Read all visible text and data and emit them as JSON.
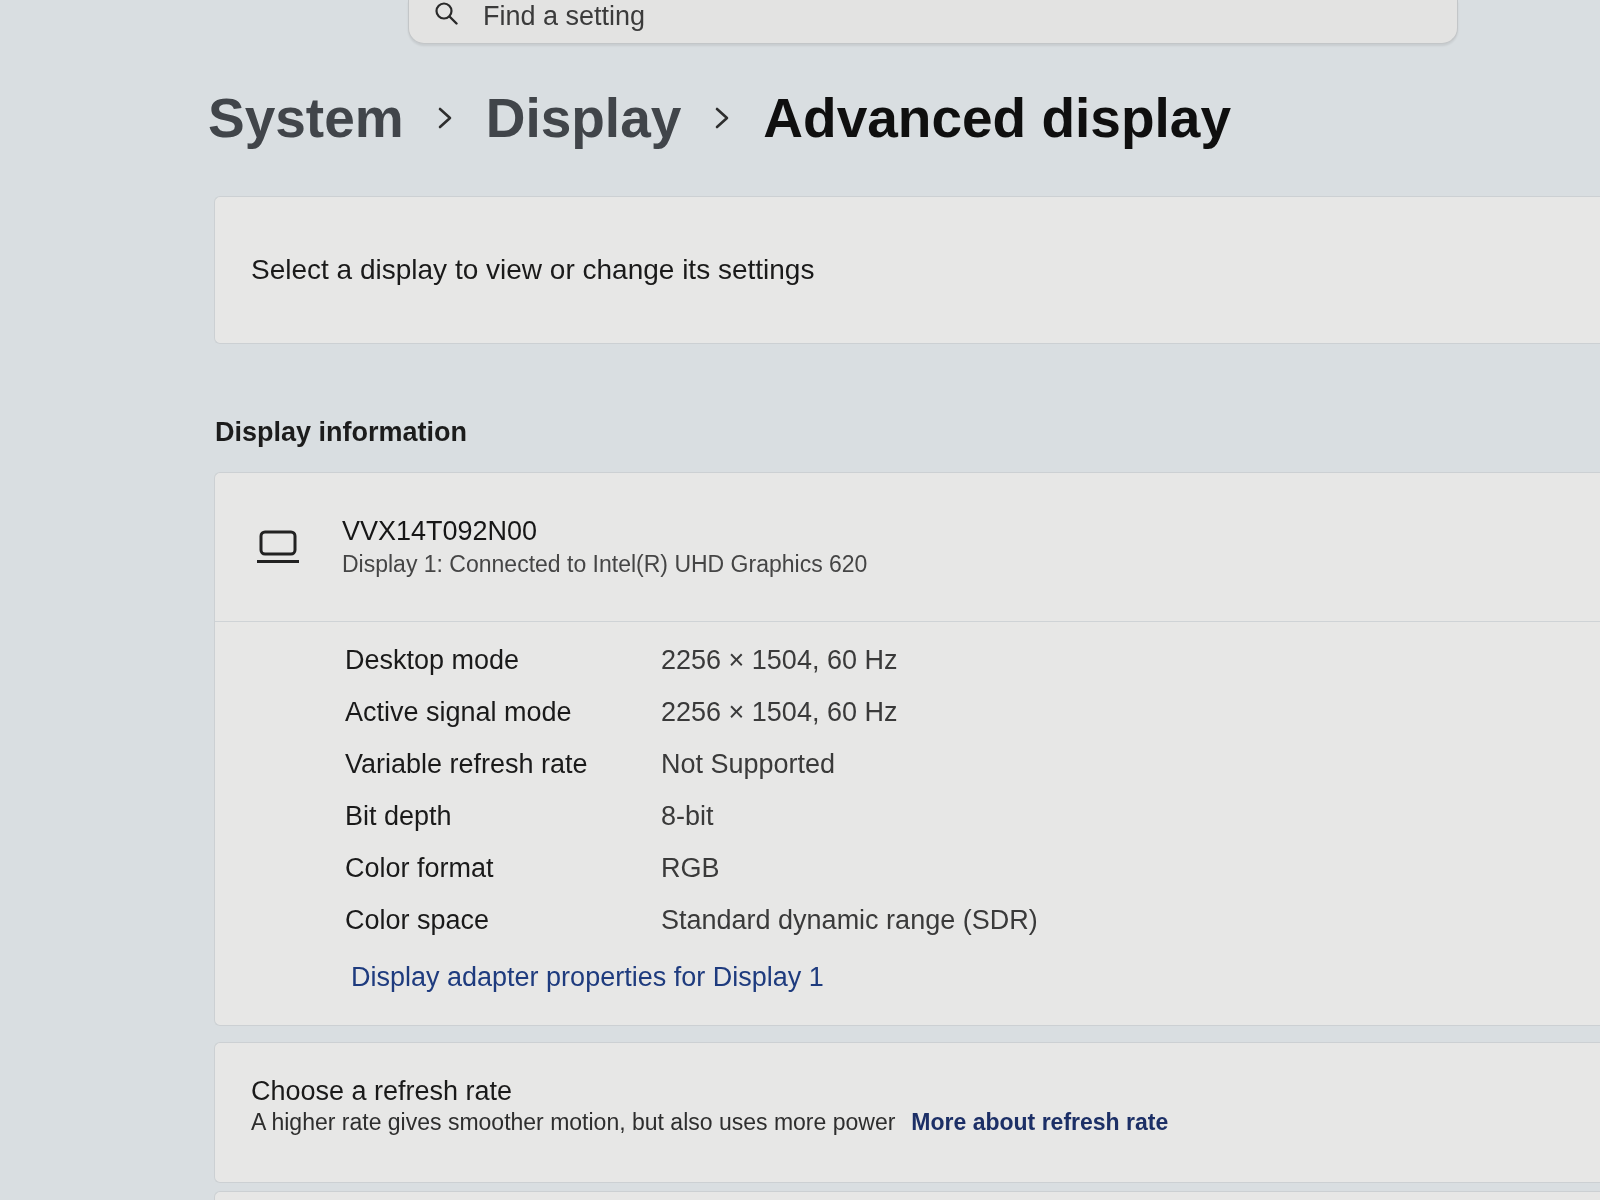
{
  "search": {
    "placeholder": "Find a setting"
  },
  "breadcrumb": [
    {
      "label": "System",
      "current": false
    },
    {
      "label": "Display",
      "current": false
    },
    {
      "label": "Advanced display",
      "current": true
    }
  ],
  "display_select": {
    "text": "Select a display to view or change its settings"
  },
  "display_information": {
    "heading": "Display information",
    "display": {
      "name": "VVX14T092N00",
      "description": "Display 1: Connected to Intel(R) UHD Graphics 620"
    },
    "properties": [
      {
        "label": "Desktop mode",
        "value": "2256 × 1504, 60 Hz"
      },
      {
        "label": "Active signal mode",
        "value": "2256 × 1504, 60 Hz"
      },
      {
        "label": "Variable refresh rate",
        "value": "Not Supported"
      },
      {
        "label": "Bit depth",
        "value": "8-bit"
      },
      {
        "label": "Color format",
        "value": "RGB"
      },
      {
        "label": "Color space",
        "value": "Standard dynamic range (SDR)"
      }
    ],
    "link": "Display adapter properties for Display 1"
  },
  "refresh_rate": {
    "title": "Choose a refresh rate",
    "description": "A higher rate gives smoother motion, but also uses more power",
    "link": "More about refresh rate"
  }
}
